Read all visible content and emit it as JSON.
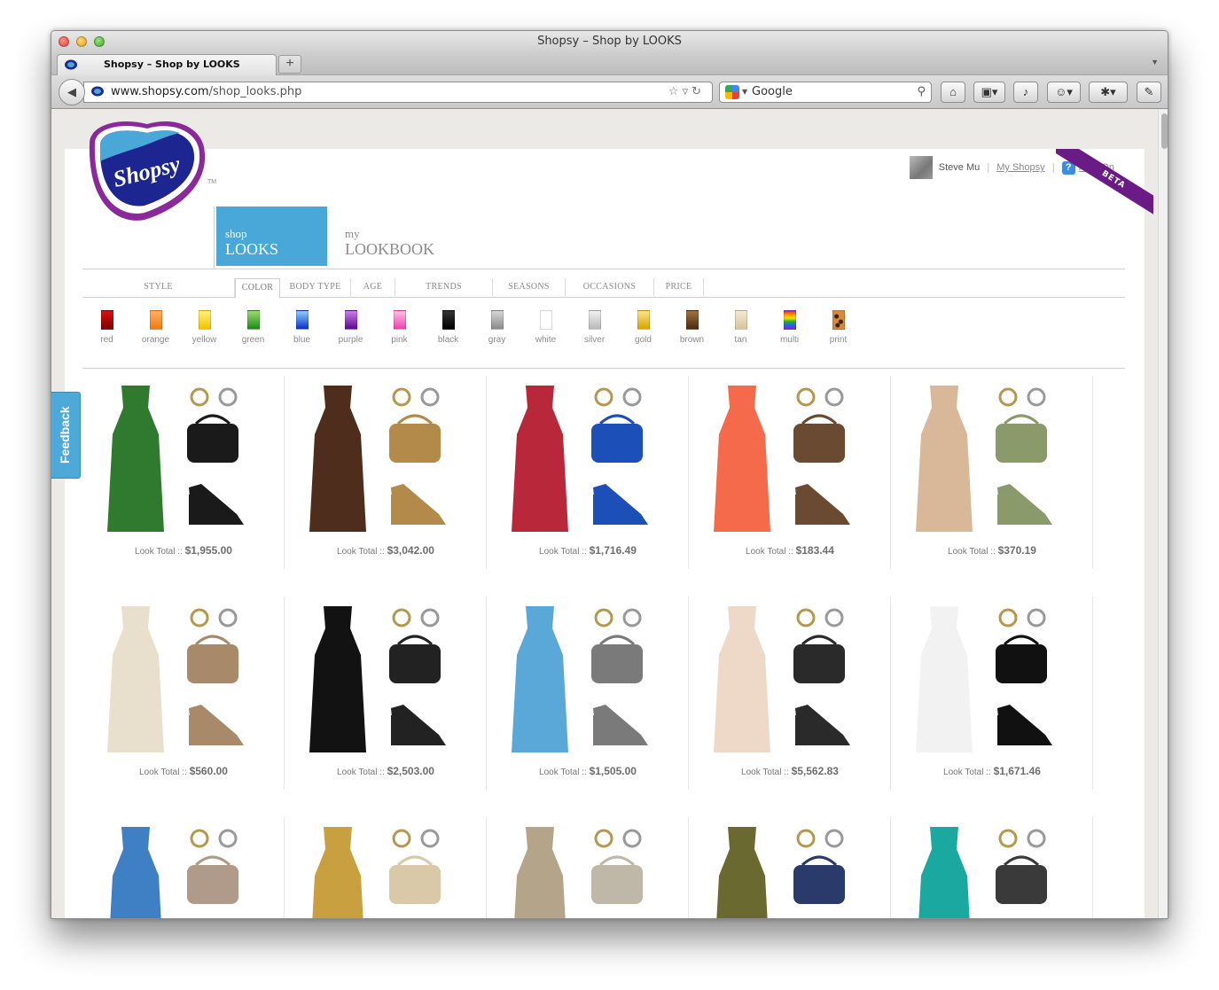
{
  "window": {
    "title": "Shopsy – Shop by LOOKS"
  },
  "tab": {
    "title": "Shopsy – Shop by LOOKS",
    "new_tab": "+"
  },
  "url": {
    "host": "www.shopsy.com",
    "path": "/shop_looks.php"
  },
  "search": {
    "engine": "Google"
  },
  "user": {
    "name": "Steve Mu",
    "my_link": "My Shopsy",
    "help": "Help On"
  },
  "brand": {
    "name": "Shopsy",
    "tm": "TM",
    "beta": "BETA"
  },
  "tabs": [
    {
      "small": "shop",
      "large": "LOOKS"
    },
    {
      "small": "my",
      "large": "LOOKBOOK"
    }
  ],
  "filters": [
    "STYLE",
    "COLOR",
    "BODY TYPE",
    "AGE",
    "TRENDS",
    "SEASONS",
    "OCCASIONS",
    "PRICE"
  ],
  "colors": [
    {
      "label": "red",
      "c1": "#e01010",
      "c2": "#7a0000"
    },
    {
      "label": "orange",
      "c1": "#ffb060",
      "c2": "#f07a14"
    },
    {
      "label": "yellow",
      "c1": "#fff27a",
      "c2": "#f2c200"
    },
    {
      "label": "green",
      "c1": "#9ade6c",
      "c2": "#1f8a1f"
    },
    {
      "label": "blue",
      "c1": "#8fd0ff",
      "c2": "#0a2fc8"
    },
    {
      "label": "purple",
      "c1": "#d07af0",
      "c2": "#5a0a8a"
    },
    {
      "label": "pink",
      "c1": "#ffc0e0",
      "c2": "#f040b0"
    },
    {
      "label": "black",
      "c1": "#333333",
      "c2": "#000000"
    },
    {
      "label": "gray",
      "c1": "#d6d6d6",
      "c2": "#8a8a8a"
    },
    {
      "label": "white",
      "c1": "#ffffff",
      "c2": "#ffffff"
    },
    {
      "label": "silver",
      "c1": "#f0f0f0",
      "c2": "#b9b9b9"
    },
    {
      "label": "gold",
      "c1": "#fbe38a",
      "c2": "#d9a400"
    },
    {
      "label": "brown",
      "c1": "#a37240",
      "c2": "#4a2a10"
    },
    {
      "label": "tan",
      "c1": "#f4ead0",
      "c2": "#d7c59c"
    },
    {
      "label": "multi",
      "c1": "#ff2020",
      "c2": "#2060ff"
    },
    {
      "label": "print",
      "c1": "#d8893a",
      "c2": "#3a2010"
    }
  ],
  "look_prefix": "Look Total ::",
  "looks": [
    {
      "total": "$1,955.00",
      "dress": "#2f7a2f",
      "acc": "#1a1a1a"
    },
    {
      "total": "$3,042.00",
      "dress": "#4e2d1d",
      "acc": "#b38a4a"
    },
    {
      "total": "$1,716.49",
      "dress": "#b8283a",
      "acc": "#1d4fb8"
    },
    {
      "total": "$183.44",
      "dress": "#f46a4a",
      "acc": "#6b4a32"
    },
    {
      "total": "$370.19",
      "dress": "#d9b89a",
      "acc": "#8a9a6a"
    },
    {
      "total": "$560.00",
      "dress": "#e8e0cc",
      "acc": "#a88a6a"
    },
    {
      "total": "$2,503.00",
      "dress": "#121212",
      "acc": "#222222"
    },
    {
      "total": "$1,505.00",
      "dress": "#5aa8d8",
      "acc": "#7a7a7a"
    },
    {
      "total": "$5,562.83",
      "dress": "#eed8c8",
      "acc": "#2a2a2a"
    },
    {
      "total": "$1,671.46",
      "dress": "#f2f2f2",
      "acc": "#111111"
    },
    {
      "total": "",
      "dress": "#3f7fc4",
      "acc": "#b09a8a"
    },
    {
      "total": "",
      "dress": "#c8a040",
      "acc": "#d9c9a8"
    },
    {
      "total": "",
      "dress": "#b4a48a",
      "acc": "#bfb8a8"
    },
    {
      "total": "",
      "dress": "#6a6a30",
      "acc": "#2a3a6a"
    },
    {
      "total": "",
      "dress": "#1aa8a0",
      "acc": "#3a3a3a"
    }
  ],
  "feedback": "Feedback"
}
